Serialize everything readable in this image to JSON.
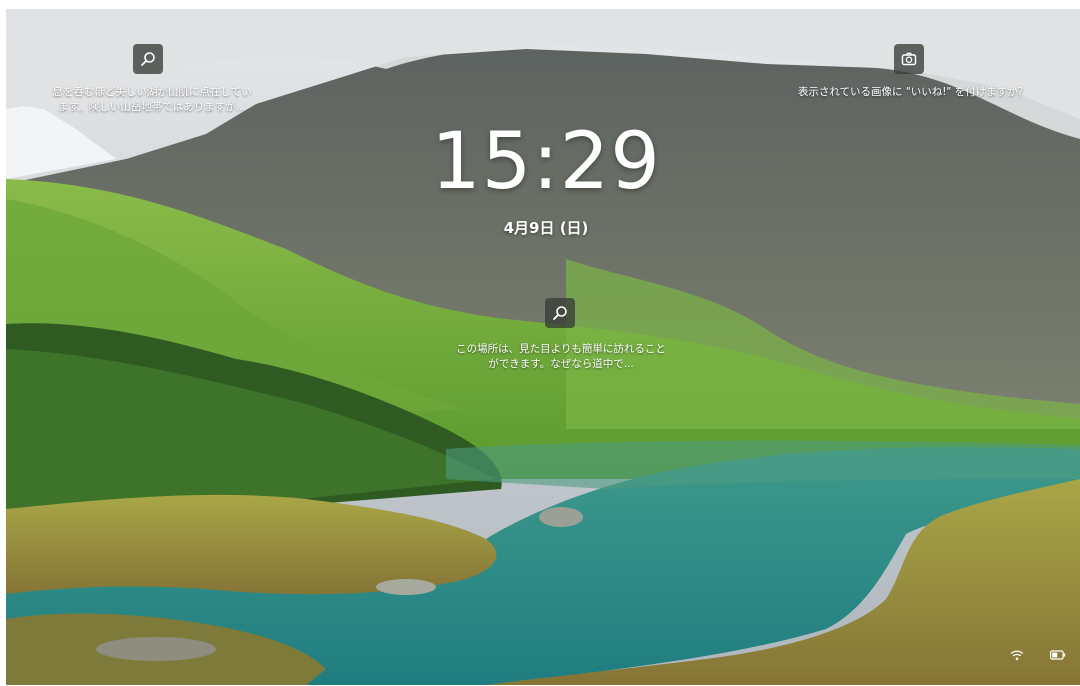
{
  "lock_screen": {
    "time": "15:29",
    "date": "4月9日 (日)"
  },
  "hotspots": {
    "left": {
      "icon": "search-icon",
      "text": "息を呑むほど美しい湖が山肌に点在してい\nます。険しい山岳地帯ではありますが..."
    },
    "right": {
      "icon": "camera-icon",
      "text": "表示されている画像に \"いいね!\" を付けますか?"
    },
    "center": {
      "icon": "search-icon",
      "text": "この場所は、見た目よりも簡単に訪れること\nができます。なぜなら道中で..."
    }
  },
  "system_tray": {
    "icons": [
      "wifi-icon",
      "battery-icon"
    ]
  },
  "colors": {
    "icon_box": "#373c37",
    "text": "#ffffff",
    "lake": "#2d8c86",
    "grass": "#7bb247"
  }
}
